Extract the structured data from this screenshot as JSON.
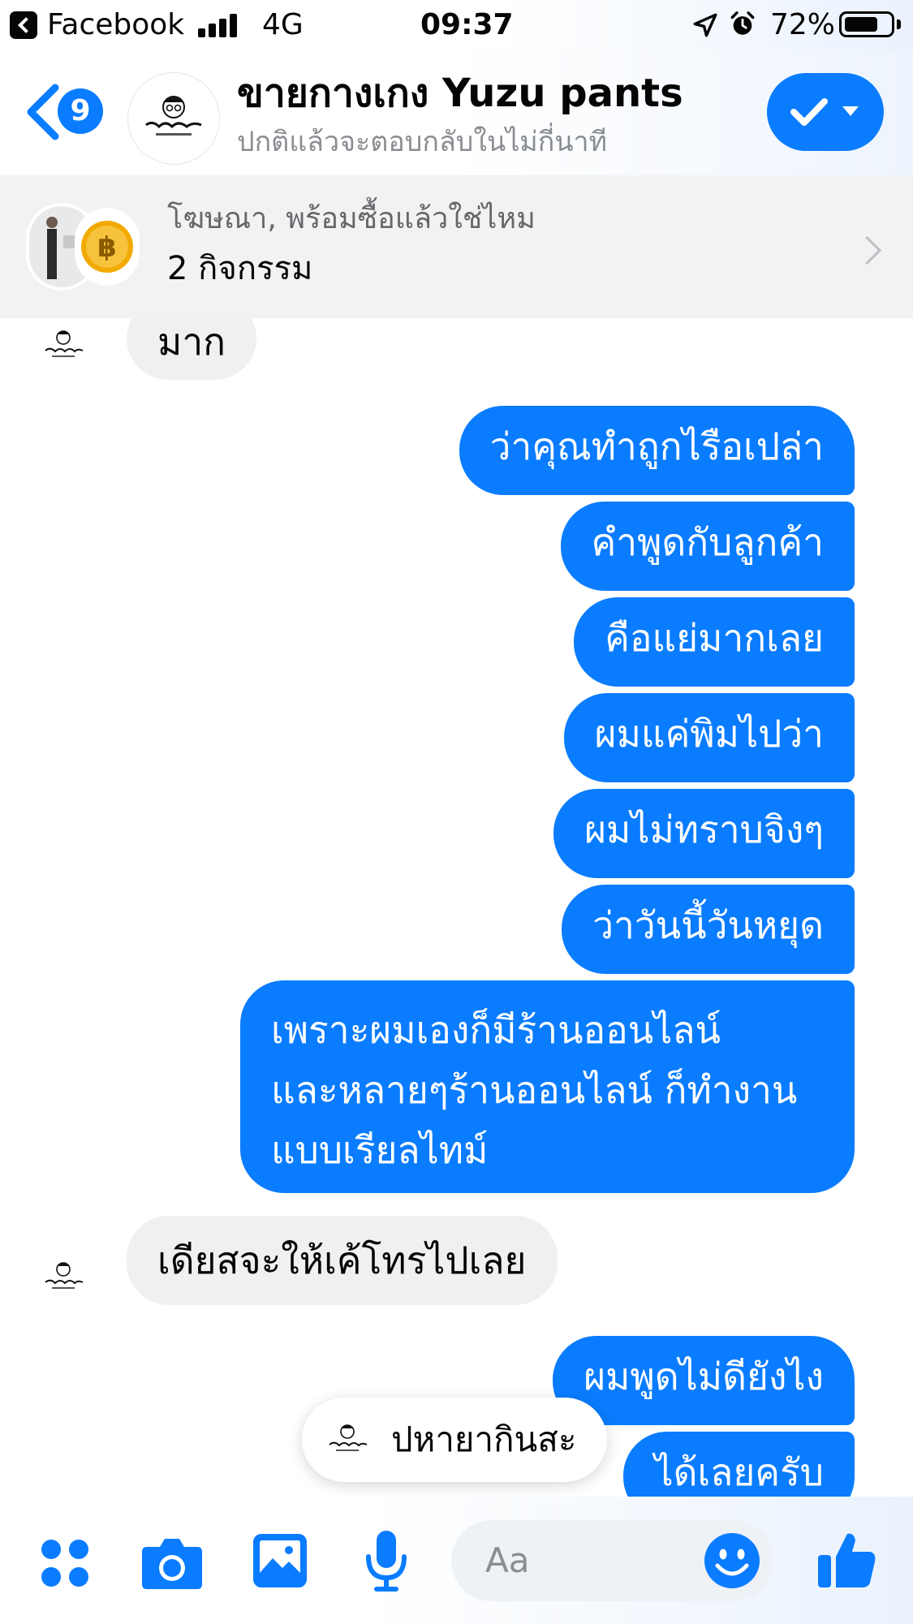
{
  "status_bar": {
    "back_app": "Facebook",
    "network": "4G",
    "time": "09:37",
    "battery": "72%",
    "battery_level": 0.72,
    "icons": [
      "back-app-icon",
      "signal-bars-icon",
      "location-arrow-icon",
      "alarm-clock-icon",
      "battery-icon"
    ]
  },
  "header": {
    "unread_count": "9",
    "title": "ขายกางเกง Yuzu pants",
    "subtitle": "ปกติแล้วจะตอบกลับในไม่กี่นาที",
    "icons": [
      "chevron-left-icon",
      "checkmark-icon",
      "caret-down-icon"
    ]
  },
  "ad_banner": {
    "line1": "โฆษณา, พร้อมซื้อแล้วใช่ไหม",
    "line2": "2 กิจกรรม",
    "icons": [
      "bitcoin-coin-icon",
      "chevron-right-icon"
    ]
  },
  "messages": [
    {
      "sender": "page",
      "text": "มาก"
    },
    {
      "sender": "me",
      "text": "ว่าคุณทำถูกไรือเปล่า"
    },
    {
      "sender": "me",
      "text": "คำพูดกับลูกค้า"
    },
    {
      "sender": "me",
      "text": "คือแย่มากเลย"
    },
    {
      "sender": "me",
      "text": "ผมแค่พิมไปว่า"
    },
    {
      "sender": "me",
      "text": "ผมไม่ทราบจิงๆ"
    },
    {
      "sender": "me",
      "text": "ว่าวันนี้วันหยุด"
    },
    {
      "sender": "me",
      "lines": [
        "เพราะผมเองก็มีร้านออนไลน์",
        "และหลายๆร้านออนไลน์ ก็ทำงาน",
        "แบบเรียลไทม์"
      ]
    },
    {
      "sender": "page",
      "text": "เดียสจะให้เค้โทรไปเลย"
    },
    {
      "sender": "me",
      "text": "ผมพูดไม่ดียังไง"
    },
    {
      "sender": "me",
      "text": "ได้เลยครับ"
    }
  ],
  "reply_chip": {
    "text": "ปหายากินสะ"
  },
  "composer": {
    "placeholder": "Aa",
    "icons": [
      "four-dots-menu-icon",
      "camera-icon",
      "photo-icon",
      "microphone-icon",
      "emoji-icon",
      "thumbs-up-icon"
    ]
  },
  "colors": {
    "accent": "#0a7cff",
    "incoming_bubble": "#f0f0f0",
    "banner_bg": "#f2f2f2",
    "secondary_text": "#8a8d91"
  }
}
